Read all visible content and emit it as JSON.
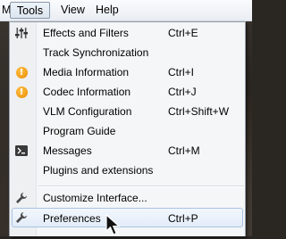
{
  "menubar": {
    "items": [
      {
        "label": "M"
      },
      {
        "label": "Tools"
      },
      {
        "label": "View"
      },
      {
        "label": "Help"
      }
    ]
  },
  "tools_menu": {
    "items": [
      {
        "label": "Effects and Filters",
        "shortcut": "Ctrl+E",
        "icon": "equalizer-sliders-icon"
      },
      {
        "label": "Track Synchronization",
        "shortcut": "",
        "icon": ""
      },
      {
        "label": "Media Information",
        "shortcut": "Ctrl+I",
        "icon": "info-icon"
      },
      {
        "label": "Codec Information",
        "shortcut": "Ctrl+J",
        "icon": "info-icon"
      },
      {
        "label": "VLM Configuration",
        "shortcut": "Ctrl+Shift+W",
        "icon": ""
      },
      {
        "label": "Program Guide",
        "shortcut": "",
        "icon": ""
      },
      {
        "label": "Messages",
        "shortcut": "Ctrl+M",
        "icon": "terminal-icon"
      },
      {
        "label": "Plugins and extensions",
        "shortcut": "",
        "icon": ""
      },
      {
        "label": "Customize Interface...",
        "shortcut": "",
        "icon": "wrench-icon"
      },
      {
        "label": "Preferences",
        "shortcut": "Ctrl+P",
        "icon": "wrench-icon"
      }
    ],
    "highlighted": "Preferences"
  },
  "colors": {
    "menu_background": "#f5f6f7",
    "highlight_border": "#a8c3e3",
    "info_icon": "#f09a10"
  }
}
